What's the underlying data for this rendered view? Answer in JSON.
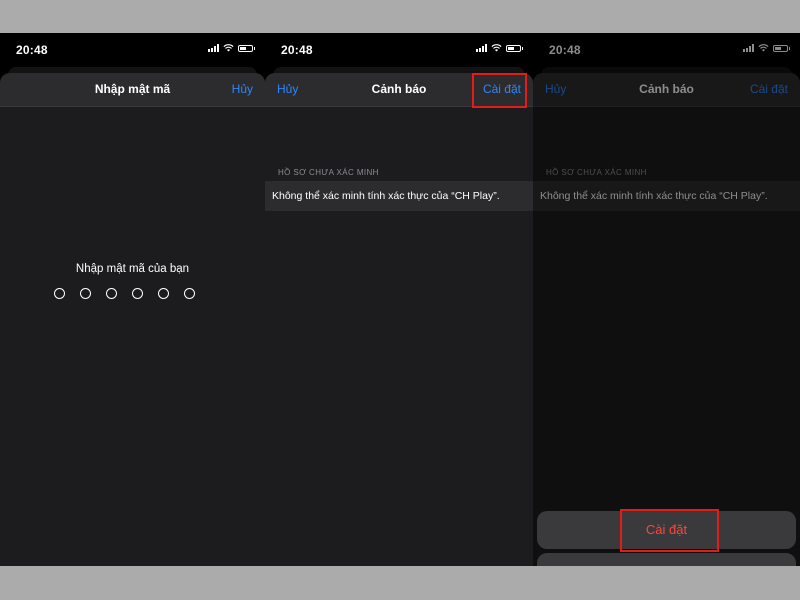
{
  "status_bar": {
    "time": "20:48"
  },
  "screen1": {
    "title": "Nhập mật mã",
    "cancel": "Hủy",
    "prompt": "Nhập mật mã của bạn",
    "passcode_length": 6
  },
  "screen2": {
    "cancel": "Hủy",
    "title": "Cảnh báo",
    "install": "Cài đặt",
    "section_header": "HỒ SƠ CHƯA XÁC MINH",
    "message": "Không thể xác minh tính xác thực của “CH Play”."
  },
  "screen3": {
    "cancel": "Hủy",
    "title": "Cảnh báo",
    "install": "Cài đặt",
    "section_header": "HỒ SƠ CHƯA XÁC MINH",
    "message": "Không thể xác minh tính xác thực của “CH Play”.",
    "action_button": "Cài đặt"
  },
  "colors": {
    "accent_blue": "#2f86f8",
    "destructive_red": "#ff453a",
    "highlight_box": "#e31b1b"
  }
}
